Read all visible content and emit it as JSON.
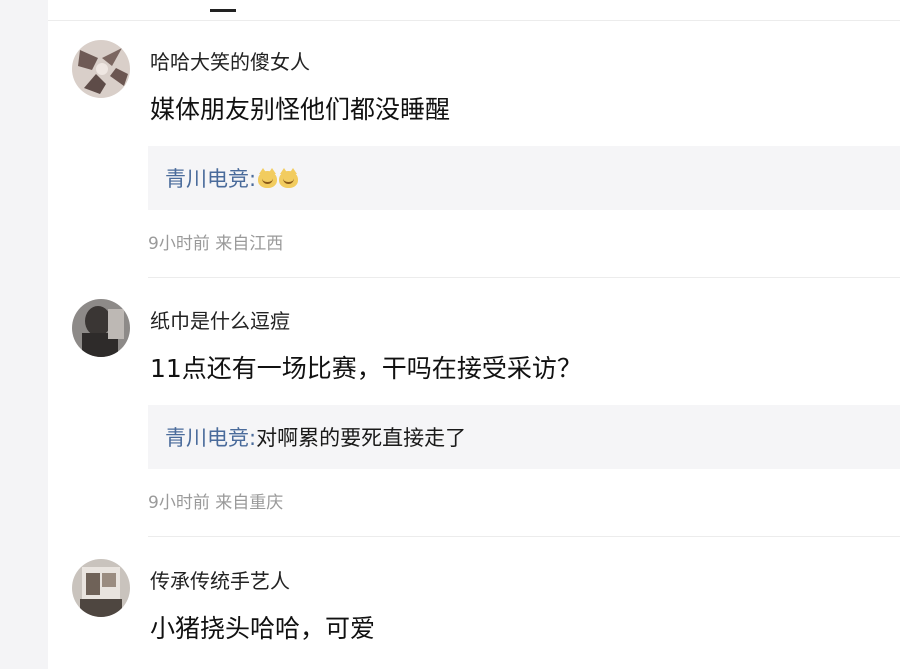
{
  "comments": [
    {
      "username": "哈哈大笑的傻女人",
      "content": "媒体朋友别怪他们都没睡醒",
      "reply": {
        "user": "青川电竞",
        "colon": ":",
        "text": "",
        "emoji": [
          "cat-face-emoji",
          "cat-face-emoji"
        ]
      },
      "meta": "9小时前 来自江西"
    },
    {
      "username": "纸巾是什么逗痘",
      "content": "11点还有一场比赛，干吗在接受采访？",
      "reply": {
        "user": "青川电竞",
        "colon": ":",
        "text": "对啊累的要死直接走了"
      },
      "meta": "9小时前 来自重庆"
    },
    {
      "username": "传承传统手艺人",
      "content": "小猪挠头哈哈，可爱"
    }
  ],
  "colors": {
    "reply_user": "#4a6b9b",
    "meta": "#9a9a9a",
    "reply_bg": "#f5f5f7"
  }
}
